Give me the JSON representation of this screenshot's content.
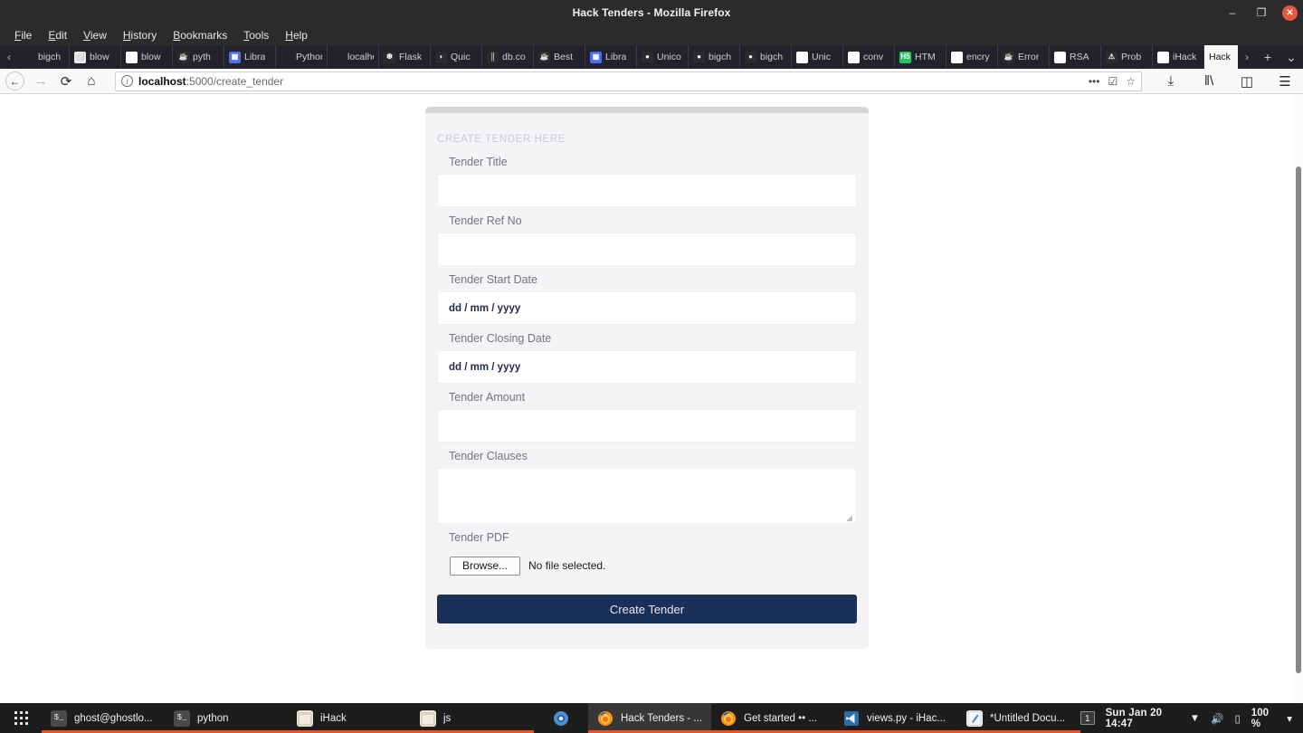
{
  "window": {
    "title": "Hack Tenders - Mozilla Firefox",
    "minimize": "–",
    "maximize": "❐",
    "close": "✕"
  },
  "menubar": {
    "items": [
      "File",
      "Edit",
      "View",
      "History",
      "Bookmarks",
      "Tools",
      "Help"
    ]
  },
  "tabbar": {
    "scroll_left": "‹",
    "scroll_right": "›",
    "new_tab": "+",
    "list_all": "⌄",
    "close_tab": "✕",
    "tabs": [
      {
        "label": "bigch",
        "icon": "plain-icon",
        "glyph": "",
        "style": "fv-plain"
      },
      {
        "label": "blow",
        "icon": "box-icon",
        "glyph": "⬜",
        "style": "fv-box"
      },
      {
        "label": "blow",
        "icon": "google-icon",
        "glyph": "G",
        "style": "fv-google"
      },
      {
        "label": "pyth",
        "icon": "java-icon",
        "glyph": "☕",
        "style": "fv-java"
      },
      {
        "label": "Libra",
        "icon": "grid-icon",
        "glyph": "▦",
        "style": "fv-grid"
      },
      {
        "label": "Python a",
        "icon": "plain-icon",
        "glyph": "",
        "style": "fv-plain"
      },
      {
        "label": "localhos",
        "icon": "plain-icon",
        "glyph": "",
        "style": "fv-plain"
      },
      {
        "label": "Flask",
        "icon": "flask-icon",
        "glyph": "❆",
        "style": "fv-flask"
      },
      {
        "label": "Quic",
        "icon": "quic-icon",
        "glyph": "◗",
        "style": "fv-quic"
      },
      {
        "label": "db.co",
        "icon": "database-icon",
        "glyph": "║",
        "style": "fv-db"
      },
      {
        "label": "Best",
        "icon": "java-icon",
        "glyph": "☕",
        "style": "fv-java"
      },
      {
        "label": "Libra",
        "icon": "grid-icon",
        "glyph": "▦",
        "style": "fv-grid"
      },
      {
        "label": "Unico",
        "icon": "github-icon",
        "glyph": "●",
        "style": "fv-github"
      },
      {
        "label": "bigch",
        "icon": "github-icon",
        "glyph": "●",
        "style": "fv-github"
      },
      {
        "label": "bigch",
        "icon": "github-icon",
        "glyph": "●",
        "style": "fv-github"
      },
      {
        "label": "Unic",
        "icon": "google-icon",
        "glyph": "G",
        "style": "fv-google"
      },
      {
        "label": "conv",
        "icon": "google-icon",
        "glyph": "G",
        "style": "fv-google"
      },
      {
        "label": "HTM",
        "icon": "html-icon",
        "glyph": "H5",
        "style": "fv-html"
      },
      {
        "label": "encry",
        "icon": "google-icon",
        "glyph": "G",
        "style": "fv-google"
      },
      {
        "label": "Error",
        "icon": "java-icon",
        "glyph": "☕",
        "style": "fv-java"
      },
      {
        "label": "RSA",
        "icon": "google-icon",
        "glyph": "G",
        "style": "fv-google"
      },
      {
        "label": "Prob",
        "icon": "warning-icon",
        "glyph": "⚠",
        "style": "fv-warn"
      },
      {
        "label": "iHack",
        "icon": "dev-icon",
        "glyph": "D",
        "style": "fv-blue-d"
      }
    ],
    "active_tab": {
      "label": "Hack",
      "icon": "plain-icon",
      "glyph": "",
      "style": "fv-plain"
    }
  },
  "navbar": {
    "back": "←",
    "forward": "→",
    "reload": "⟳",
    "home": "⌂",
    "url_host": "localhost",
    "url_path": ":5000/create_tender",
    "info_icon": "i",
    "page_actions": "•••",
    "reader_icon": "☑",
    "bookmark_icon": "☆",
    "downloads_icon": "⤓",
    "library_icon": "‖\\",
    "sidebar_icon": "◫",
    "menu_icon": "☰"
  },
  "page": {
    "heading": "CREATE TENDER HERE",
    "fields": [
      {
        "label": "Tender Title",
        "type": "text",
        "value": "",
        "name": "tender-title"
      },
      {
        "label": "Tender Ref No",
        "type": "text",
        "value": "",
        "name": "tender-ref-no"
      },
      {
        "label": "Tender Start Date",
        "type": "date",
        "value": "dd / mm / yyyy",
        "name": "tender-start-date"
      },
      {
        "label": "Tender Closing Date",
        "type": "date",
        "value": "dd / mm / yyyy",
        "name": "tender-closing-date"
      },
      {
        "label": "Tender Amount",
        "type": "text",
        "value": "",
        "name": "tender-amount"
      },
      {
        "label": "Tender Clauses",
        "type": "textarea",
        "value": "",
        "name": "tender-clauses"
      },
      {
        "label": "Tender PDF",
        "type": "file",
        "value": "",
        "name": "tender-pdf"
      }
    ],
    "file_browse_label": "Browse...",
    "file_status": "No file selected.",
    "submit_label": "Create Tender",
    "colors": {
      "submit_bg": "#1a3059",
      "card_bg": "#f4f4f7",
      "card_topbar": "#d6d6d9",
      "label": "#71757f",
      "heading": "#c9cad2"
    }
  },
  "taskbar": {
    "apps_label": "show-applications",
    "items": [
      {
        "label": "ghost@ghostlo...",
        "icon": "terminal-icon",
        "glyph": "$_",
        "style": "ti-term",
        "active": false,
        "running": true
      },
      {
        "label": "python",
        "icon": "terminal-icon",
        "glyph": "$_",
        "style": "ti-term",
        "active": false,
        "running": true
      },
      {
        "label": "iHack",
        "icon": "folder-icon",
        "glyph": "",
        "style": "ti-folder",
        "active": false,
        "running": true
      },
      {
        "label": "js",
        "icon": "folder-icon",
        "glyph": "",
        "style": "ti-folder",
        "active": false,
        "running": true
      },
      {
        "label": "",
        "icon": "chromium-icon",
        "glyph": "◉",
        "style": "ti-chrome",
        "active": false,
        "running": false
      },
      {
        "label": "Hack Tenders - ...",
        "icon": "firefox-icon",
        "glyph": "🦊",
        "style": "ti-ff",
        "active": true,
        "running": true
      },
      {
        "label": "Get started •• ...",
        "icon": "firefox-icon",
        "glyph": "🦊",
        "style": "ti-ff",
        "active": false,
        "running": true
      },
      {
        "label": "views.py - iHac...",
        "icon": "vscode-icon",
        "glyph": "❰❱",
        "style": "ti-vscode",
        "active": false,
        "running": true
      },
      {
        "label": "*Untitled Docu...",
        "icon": "texteditor-icon",
        "glyph": "✎",
        "style": "ti-text",
        "active": false,
        "running": true
      }
    ],
    "workspace": "1",
    "clock": "Sun Jan 20  14:47",
    "network_icon": "▼",
    "volume_icon": "🔊",
    "battery_icon": "▯",
    "battery_pct": "100 %",
    "dropdown_icon": "▾"
  }
}
